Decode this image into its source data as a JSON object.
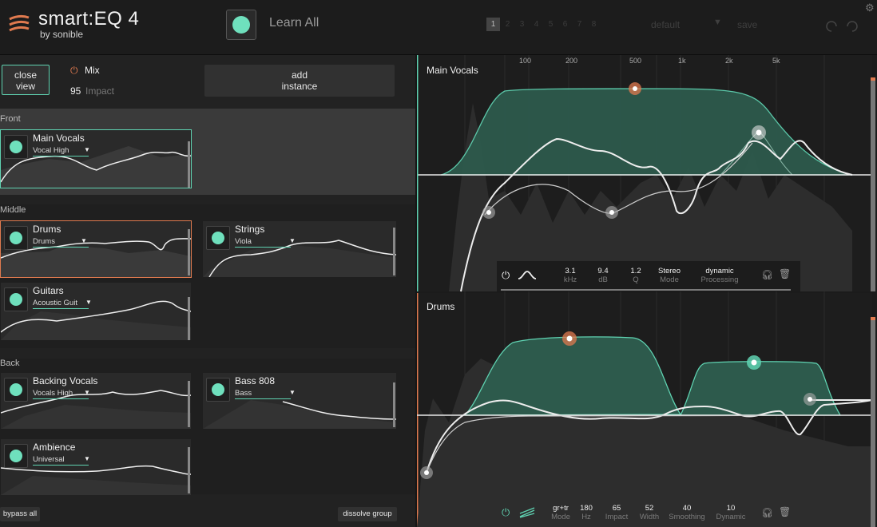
{
  "app": {
    "logo_main": "smart:EQ 4",
    "logo_sub": "by sonible",
    "learn_all": "Learn All",
    "slots": [
      "1",
      "2",
      "3",
      "4",
      "5",
      "6",
      "7",
      "8"
    ],
    "preset": "default",
    "save": "save"
  },
  "left": {
    "close_view": "close\nview",
    "mix_label": "Mix",
    "impact_value": "95",
    "impact_label": "Impact",
    "add_instance": "add\ninstance",
    "groups": {
      "front": "Front",
      "middle": "Middle",
      "back": "Back"
    },
    "cards": [
      {
        "name": "Main Vocals",
        "profile": "Vocal High"
      },
      {
        "name": "Drums",
        "profile": "Drums"
      },
      {
        "name": "Strings",
        "profile": "Viola"
      },
      {
        "name": "Guitars",
        "profile": "Acoustic Guit"
      },
      {
        "name": "Backing Vocals",
        "profile": "Vocals High"
      },
      {
        "name": "Bass 808",
        "profile": "Bass"
      },
      {
        "name": "Ambience",
        "profile": "Universal"
      }
    ],
    "bypass_all": "bypass all",
    "dissolve_group": "dissolve group"
  },
  "right": {
    "freq_labels": [
      "100",
      "200",
      "500",
      "1k",
      "2k",
      "5k"
    ],
    "panel1": {
      "title": "Main Vocals",
      "controls": [
        {
          "value": "3.1",
          "label": "kHz"
        },
        {
          "value": "9.4",
          "label": "dB"
        },
        {
          "value": "1.2",
          "label": "Q"
        },
        {
          "value": "Stereo",
          "label": "Mode"
        },
        {
          "value": "dynamic",
          "label": "Processing"
        }
      ]
    },
    "panel2": {
      "title": "Drums",
      "controls": [
        {
          "value": "gr+tr",
          "label": "Mode"
        },
        {
          "value": "180",
          "label": "Hz"
        },
        {
          "value": "65",
          "label": "Impact"
        },
        {
          "value": "52",
          "label": "Width"
        },
        {
          "value": "40",
          "label": "Smoothing"
        },
        {
          "value": "10",
          "label": "Dynamic"
        }
      ]
    }
  },
  "colors": {
    "accent": "#6fe0bd",
    "orange": "#e07a4f"
  }
}
